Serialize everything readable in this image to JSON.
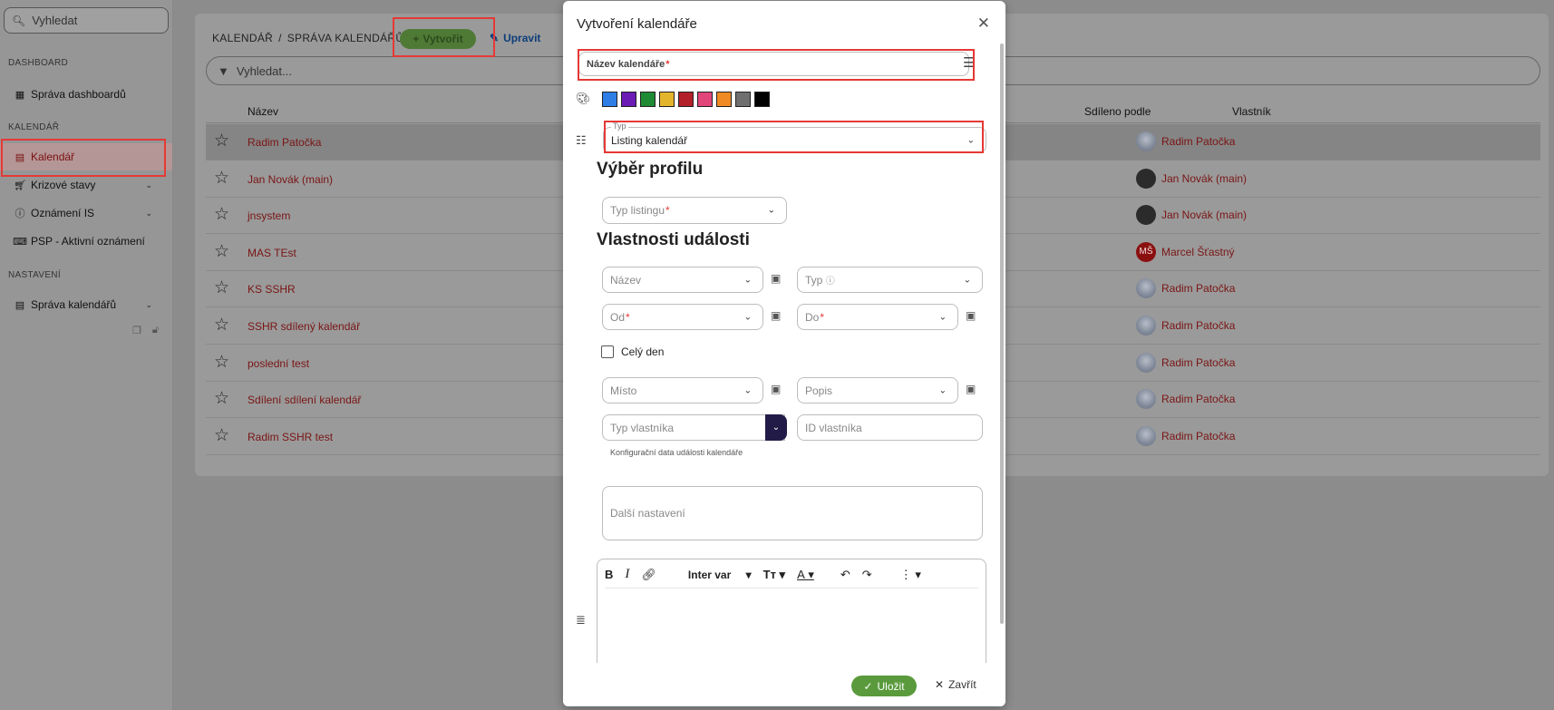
{
  "sidebar": {
    "search_placeholder": "Vyhledat",
    "sections": {
      "dashboard": "DASHBOARD",
      "calendar": "KALENDÁŘ",
      "settings": "NASTAVENÍ"
    },
    "items": [
      {
        "label": "Správa dashboardů",
        "icon": "dashboard-icon"
      },
      {
        "label": "Kalendář",
        "icon": "calendar-icon",
        "active": true
      },
      {
        "label": "Krizové stavy",
        "icon": "cart-icon"
      },
      {
        "label": "Oznámení IS",
        "icon": "info-icon"
      },
      {
        "label": "PSP - Aktivní oznámení",
        "icon": "keyboard-icon"
      },
      {
        "label": "Správa kalendářů",
        "icon": "calendar-settings-icon"
      }
    ]
  },
  "header": {
    "breadcrumb_root": "KALENDÁŘ",
    "breadcrumb_sep": "/",
    "breadcrumb_current": "SPRÁVA KALENDÁŘŮ",
    "create_label": "Vytvořit",
    "edit_label": "Upravit"
  },
  "search": {
    "placeholder": "Vyhledat..."
  },
  "table": {
    "columns": [
      "Název",
      "Sdíleno podle",
      "Vlastník"
    ],
    "rows": [
      {
        "name": "Radim Patočka",
        "owner": "Radim Patočka",
        "avatar": "img"
      },
      {
        "name": "Jan Novák (main)",
        "owner": "Jan Novák (main)",
        "avatar": "dark"
      },
      {
        "name": "jnsystem",
        "owner": "Jan Novák (main)",
        "avatar": "dark"
      },
      {
        "name": "MAS TEst",
        "owner": "Marcel Šťastný",
        "avatar": "initials",
        "initials": "MŠ"
      },
      {
        "name": "KS SSHR",
        "owner": "Radim Patočka",
        "avatar": "img"
      },
      {
        "name": "SSHR sdílený kalendář",
        "owner": "Radim Patočka",
        "avatar": "img"
      },
      {
        "name": "poslední test",
        "owner": "Radim Patočka",
        "avatar": "img"
      },
      {
        "name": "Sdílení sdílení kalendář",
        "owner": "Radim Patočka",
        "avatar": "img"
      },
      {
        "name": "Radim SSHR test",
        "owner": "Radim Patočka",
        "avatar": "img"
      }
    ]
  },
  "modal": {
    "title": "Vytvoření kalendáře",
    "name_field": {
      "label": "Název kalendáře",
      "required": "*"
    },
    "colors": [
      "#2f7ee6",
      "#6a1cb5",
      "#1f8a34",
      "#e3b52d",
      "#b3202a",
      "#e2457a",
      "#f08a24",
      "#6f6f6f",
      "#000000"
    ],
    "type_field": {
      "label": "Typ",
      "value": "Listing kalendář"
    },
    "section_profile": "Výběr profilu",
    "listing_type": {
      "label": "Typ listingu",
      "required": "*"
    },
    "section_event": "Vlastnosti události",
    "fields": {
      "nazev": "Název",
      "typ": "Typ",
      "od": "Od",
      "do": "Do",
      "misto": "Místo",
      "popis": "Popis",
      "typ_vlastnika": "Typ vlastníka",
      "id_vlastnika": "ID vlastníka",
      "required": "*"
    },
    "all_day": "Celý den",
    "config_hint": "Konfigurační data události kalendáře",
    "more_settings": "Další nastavení",
    "editor": {
      "font": "Inter var"
    },
    "save_label": "Uložit",
    "close_label": "Zavřít"
  }
}
